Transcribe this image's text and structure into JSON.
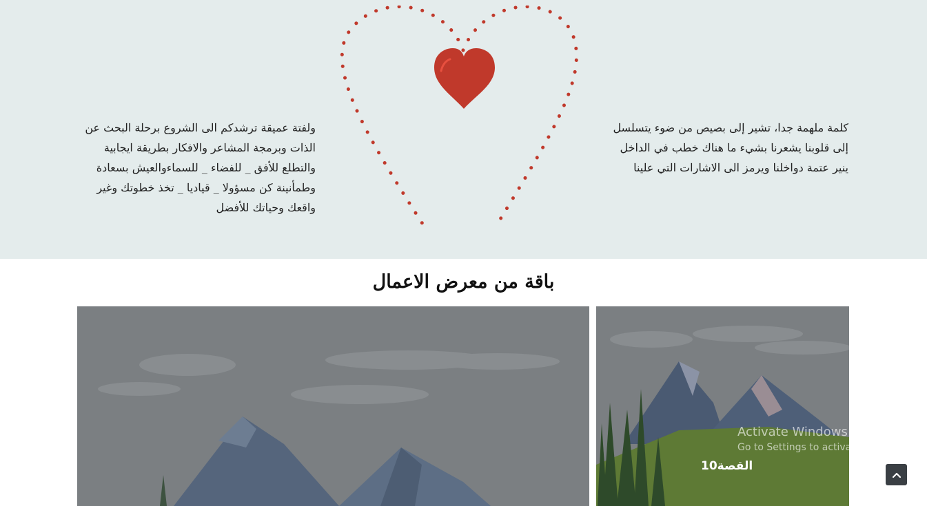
{
  "hero": {
    "quote_right": "كلمة ملهمة جدا، تشير إلى بصيص من ضوء يتسلسل إلى قلوبنا يشعرنا بشيء ما هناك خطب في الداخل ينير عتمة دواخلنا ويرمز الى الاشارات التي علينا",
    "quote_left": "ولفتة عميقة ترشدكم الى الشروع برحلة البحث عن الذات وبرمجة المشاعر والافكار بطريقة ايجابية والتطلع للأفق _ للفضاء _ للسماءوالعيش بسعادة وطمأنينة كن مسؤولا _ قياديا _ تخذ خطوتك وغير واقعك وحياتك للأفضل",
    "heart_color": "#c0392b",
    "background_color": "#e4ecec"
  },
  "gallery": {
    "title": "باقة من معرض الاعمال",
    "small_item_label": "القصة10"
  },
  "watermark": {
    "title": "Activate Windows",
    "subtitle": "Go to Settings to activate Windows."
  },
  "scroll_top": {
    "icon": "chevron-up-icon"
  }
}
